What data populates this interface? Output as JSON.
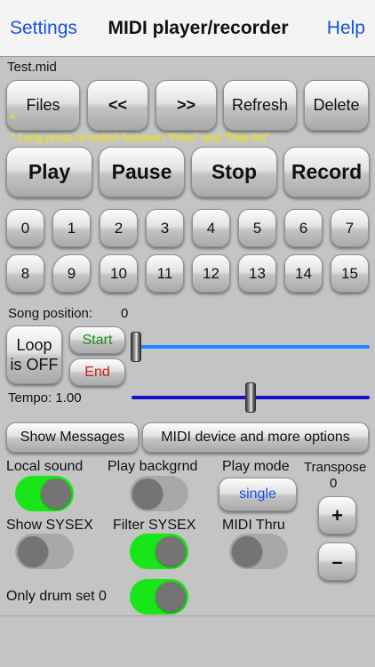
{
  "nav": {
    "left": "Settings",
    "title": "MIDI player/recorder",
    "right": "Help"
  },
  "file_name": "Test.mid",
  "file_buttons": [
    "Files",
    "<<",
    ">>",
    "Refresh",
    "Delete"
  ],
  "star": "*",
  "note": "* Long press to switch between \"Files\" and \"Play list\"",
  "transport": [
    "Play",
    "Pause",
    "Stop",
    "Record"
  ],
  "channels": [
    "0",
    "1",
    "2",
    "3",
    "4",
    "5",
    "6",
    "7",
    "8",
    "9",
    "10",
    "11",
    "12",
    "13",
    "14",
    "15"
  ],
  "song_position": {
    "label": "Song position:",
    "value": "0"
  },
  "loop": {
    "line1": "Loop",
    "line2": "is OFF",
    "start": "Start",
    "end": "End",
    "position_fraction": 0.0
  },
  "tempo": {
    "label": "Tempo: 1.00",
    "position_fraction": 0.5
  },
  "actions": {
    "show_messages": "Show Messages",
    "midi_device": "MIDI device and more options"
  },
  "options": {
    "local_sound": {
      "label": "Local sound",
      "on": true
    },
    "play_background": {
      "label": "Play backgrnd",
      "on": false
    },
    "play_mode": {
      "label": "Play mode",
      "value": "single"
    },
    "transpose": {
      "label": "Transpose",
      "value": "0",
      "plus": "+",
      "minus": "–"
    },
    "show_sysex": {
      "label": "Show SYSEX",
      "on": false
    },
    "filter_sysex": {
      "label": "Filter SYSEX",
      "on": true
    },
    "midi_thru": {
      "label": "MIDI Thru",
      "on": false
    },
    "only_drum": {
      "label": "Only drum set 0",
      "on": true
    }
  },
  "colors": {
    "accent_blue": "#1553e0",
    "slider_loop": "#1a8cff",
    "slider_tempo": "#1111cc",
    "toggle_on": "#19e619",
    "note_yellow": "#f0e600",
    "start_green": "#1a8a1a",
    "end_red": "#cc1a1a"
  },
  "icons": {
    "toggle": "switch-icon",
    "thumb": "slider-thumb-icon"
  }
}
